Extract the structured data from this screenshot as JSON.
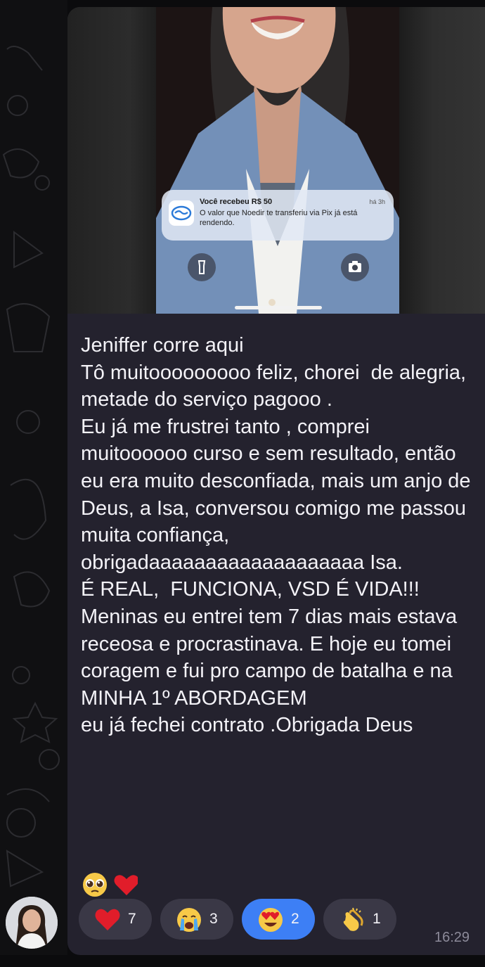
{
  "notification": {
    "title": "Você recebeu R$ 50",
    "time": "há 3h",
    "body": "O valor que Noedir te transferiu via Pix já está rendendo."
  },
  "message": {
    "text": "Jeniffer corre aqui\nTô muitooooooooo feliz, chorei  de alegria, metade do serviço pagooo .\nEu já me frustrei tanto , comprei muitoooooo curso e sem resultado, então eu era muito desconfiada, mais um anjo de Deus, a Isa, conversou comigo me passou muita confiança,\nobrigadaaaaaaaaaaaaaaaaaaa Isa.\nÉ REAL,  FUNCIONA, VSD É VIDA!!!\nMeninas eu entrei tem 7 dias mais estava receosa e procrastinava. E hoje eu tomei coragem e fui pro campo de batalha e na MINHA 1º ABORDAGEM\neu já fechei contrato .Obrigada Deus"
  },
  "reactions": [
    {
      "emoji": "heart",
      "count": "7",
      "active": false
    },
    {
      "emoji": "crying-face",
      "count": "3",
      "active": false
    },
    {
      "emoji": "heart-eyes",
      "count": "2",
      "active": true
    },
    {
      "emoji": "clapping-hands",
      "count": "1",
      "active": false
    }
  ],
  "timestamp": "16:29",
  "colors": {
    "bubble": "#24222e",
    "reaction": "#3a3846",
    "reaction_active": "#3d7ff5",
    "text": "#f3f2f7",
    "timestamp": "#8c8a99"
  }
}
